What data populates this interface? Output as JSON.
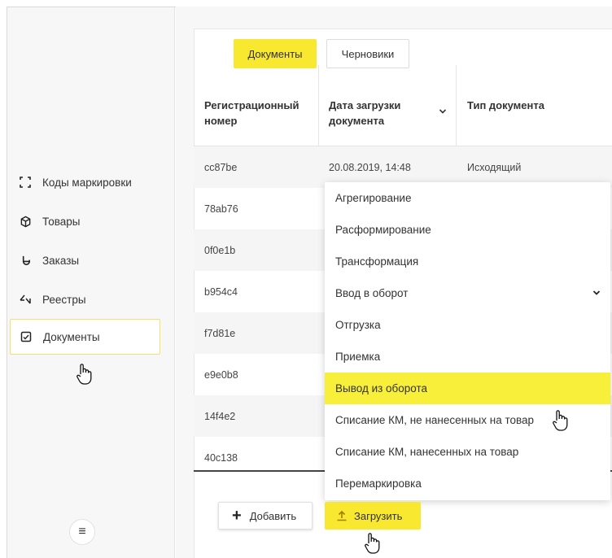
{
  "sidebar": {
    "items": [
      {
        "label": "Коды маркировки",
        "icon": "scan-icon"
      },
      {
        "label": "Товары",
        "icon": "box-icon"
      },
      {
        "label": "Заказы",
        "icon": "order-icon"
      },
      {
        "label": "Реестры",
        "icon": "exchange-icon"
      },
      {
        "label": "Документы",
        "icon": "document-icon"
      }
    ],
    "menu_icon": "menu-icon"
  },
  "tabs": [
    {
      "label": "Документы",
      "active": true
    },
    {
      "label": "Черновики",
      "active": false
    }
  ],
  "table": {
    "columns": [
      "Регистрационный номер",
      "Дата загрузки документа",
      "Тип документа"
    ],
    "rows": [
      {
        "reg": "cc87be",
        "date": "20.08.2019, 14:48",
        "type": "Исходящий"
      },
      {
        "reg": "78ab76"
      },
      {
        "reg": "0f0e1b"
      },
      {
        "reg": "b954c4"
      },
      {
        "reg": "f7d81e"
      },
      {
        "reg": "e9e0b8"
      },
      {
        "reg": "14f4e2"
      },
      {
        "reg": "40c138"
      }
    ]
  },
  "dropdown": {
    "items": [
      {
        "label": "Агрегирование"
      },
      {
        "label": "Расформирование"
      },
      {
        "label": "Трансформация"
      },
      {
        "label": "Ввод в оборот",
        "has_submenu": true
      },
      {
        "label": "Отгрузка"
      },
      {
        "label": "Приемка"
      },
      {
        "label": "Вывод из оборота",
        "highlighted": true
      },
      {
        "label": "Списание КМ, не нанесенных на товар"
      },
      {
        "label": "Списание КМ, нанесенных на товар"
      },
      {
        "label": "Перемаркировка"
      }
    ]
  },
  "buttons": {
    "add_label": "Добавить",
    "upload_label": "Загрузить"
  },
  "colors": {
    "accent": "#f8e830",
    "highlight": "#f8ef3a",
    "sidebar_bg": "#f7f7f7"
  }
}
